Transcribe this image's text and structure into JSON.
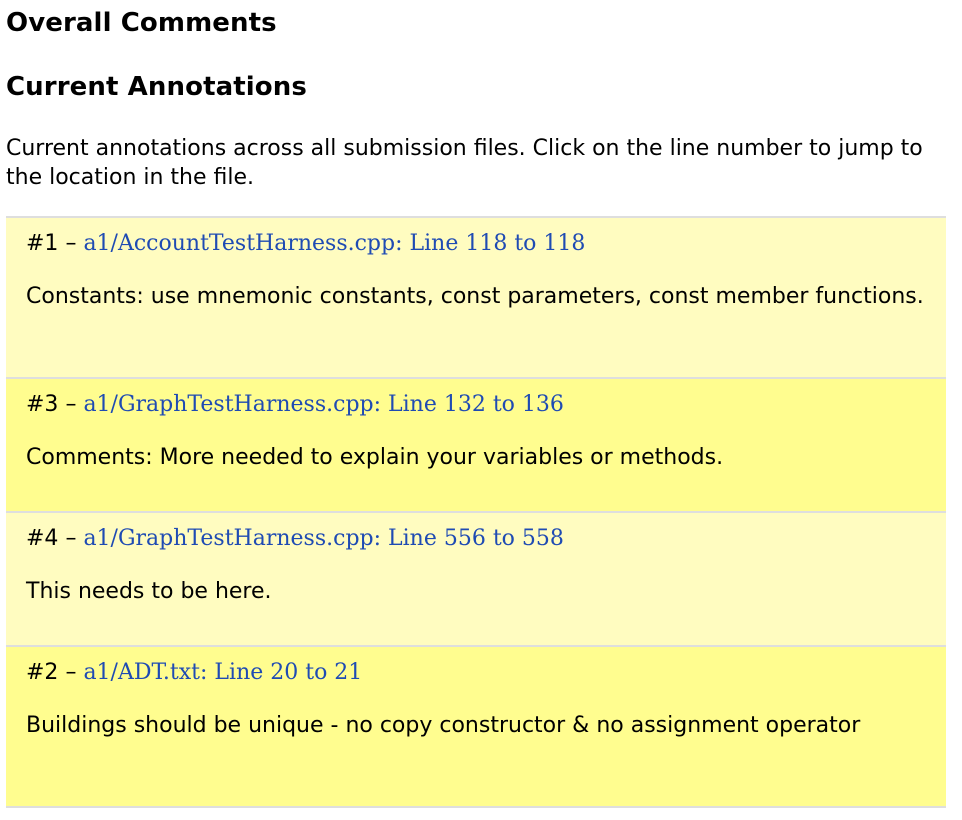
{
  "headings": {
    "overall": "Overall Comments",
    "current": "Current Annotations"
  },
  "intro": "Current annotations across all submission files. Click on the line number to jump to the location in the file.",
  "colors": {
    "annotation_bg_light": "#fffcc0",
    "annotation_bg_bright": "#fffd8f",
    "link": "#1f4bb3",
    "divider": "#dedede"
  },
  "annotations": [
    {
      "number": "#1",
      "separator": "–",
      "link": "a1/AccountTestHarness.cpp: Line 118 to 118",
      "text": "Constants: use mnemonic constants, const parameters, const member functions."
    },
    {
      "number": "#3",
      "separator": "–",
      "link": "a1/GraphTestHarness.cpp: Line 132 to 136",
      "text": "Comments: More needed to explain your variables or methods."
    },
    {
      "number": "#4",
      "separator": "–",
      "link": "a1/GraphTestHarness.cpp: Line 556 to 558",
      "text": "This needs to be here."
    },
    {
      "number": "#2",
      "separator": "–",
      "link": "a1/ADT.txt: Line 20 to 21",
      "text": "Buildings should be unique - no copy constructor & no assignment operator"
    }
  ]
}
